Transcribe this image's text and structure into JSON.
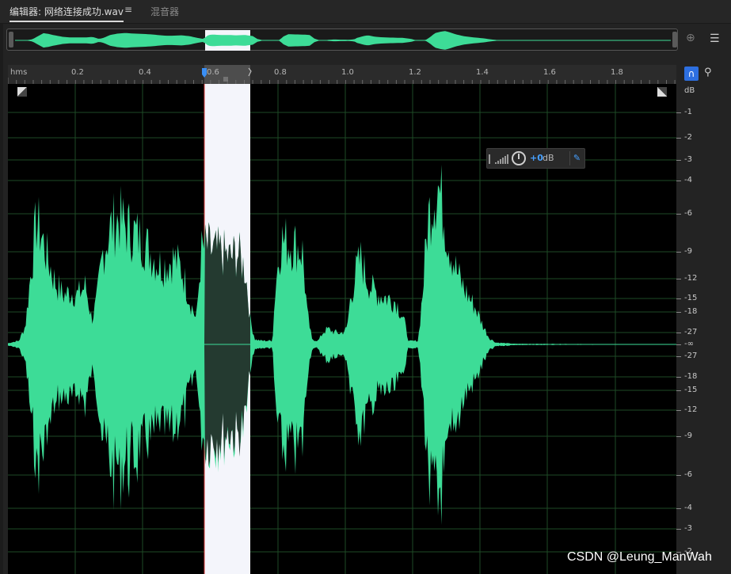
{
  "tabs": {
    "editor_label": "编辑器: 网络连接成功.wav",
    "menu_glyph": "≡",
    "mixer_label": "混音器"
  },
  "ruler": {
    "unit": "hms",
    "ticks": [
      "0.2",
      "0.4",
      "0.6",
      "0.8",
      "1.0",
      "1.2",
      "1.4",
      "1.6",
      "1.8"
    ]
  },
  "db_scale": {
    "unit": "dB",
    "labels_top": [
      "-1",
      "-2",
      "-3",
      "-4",
      "-6",
      "-9",
      "-12",
      "-15",
      "-18",
      "-27"
    ],
    "center": "-∞",
    "labels_bottom": [
      "-27",
      "-18",
      "-15",
      "-12",
      "-9",
      "-6",
      "-4",
      "-3",
      "-2"
    ]
  },
  "volume_hud": {
    "plus_value": "+0",
    "unit": "dB"
  },
  "selection": {
    "start_s": 0.578,
    "end_s": 0.715
  },
  "icons": {
    "hud_meter": "level-meter-icon",
    "hud_pin": "pin-icon",
    "zoom": "zoom-icon",
    "menu": "menu-icon",
    "magnet": "snap-magnet-icon",
    "marker": "marker-pin-icon"
  },
  "colors": {
    "waveform": "#3ddc97",
    "waveform_selected": "#243a30",
    "selection_bg": "#f4f5fb",
    "playhead": "#3a8ff5"
  },
  "watermark": "CSDN @Leung_ManWah"
}
